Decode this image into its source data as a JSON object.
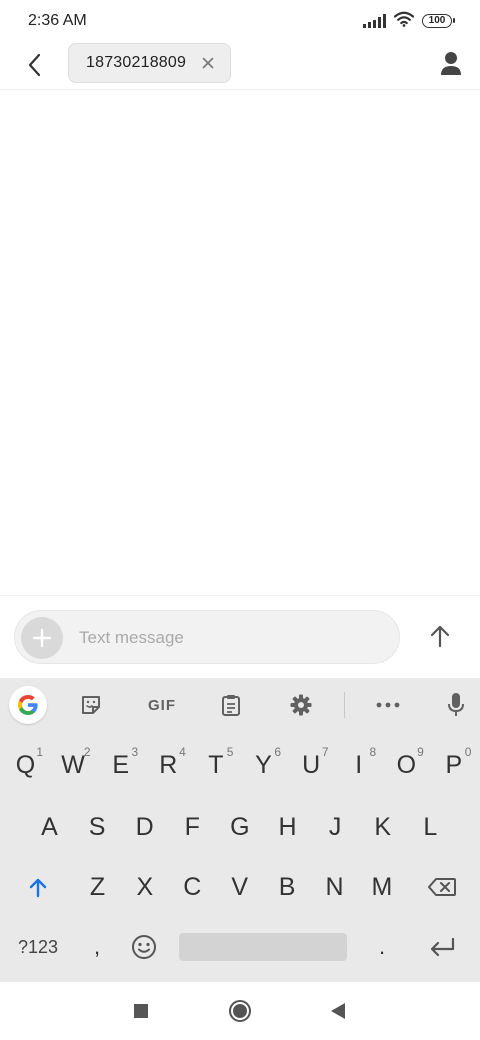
{
  "status_bar": {
    "time": "2:36 AM",
    "battery_level": "100",
    "icons": [
      "signal-icon",
      "wifi-icon",
      "battery-icon"
    ]
  },
  "header": {
    "back_icon": "chevron-left-icon",
    "recipient": "18730218809",
    "remove_icon": "close-icon",
    "contact_icon": "person-icon"
  },
  "compose": {
    "add_icon": "plus-icon",
    "placeholder": "Text message",
    "value": "",
    "send_icon": "arrow-up-icon"
  },
  "keyboard": {
    "toolbar": {
      "google_icon": "google-g-icon",
      "sticker_icon": "sticker-icon",
      "gif_label": "GIF",
      "clipboard_icon": "clipboard-icon",
      "settings_icon": "gear-icon",
      "more_icon": "more-horizontal-icon",
      "mic_icon": "microphone-icon"
    },
    "row1": [
      "Q",
      "W",
      "E",
      "R",
      "T",
      "Y",
      "U",
      "I",
      "O",
      "P"
    ],
    "row1_hints": [
      "1",
      "2",
      "3",
      "4",
      "5",
      "6",
      "7",
      "8",
      "9",
      "0"
    ],
    "row2": [
      "A",
      "S",
      "D",
      "F",
      "G",
      "H",
      "J",
      "K",
      "L"
    ],
    "row3": [
      "Z",
      "X",
      "C",
      "V",
      "B",
      "N",
      "M"
    ],
    "shift_icon": "shift-arrow-icon",
    "backspace_icon": "backspace-icon",
    "symbols_label": "?123",
    "comma_label": ",",
    "emoji_icon": "emoji-icon",
    "period_label": ".",
    "enter_icon": "enter-icon"
  },
  "nav_bar": {
    "recents_icon": "square-icon",
    "home_icon": "circle-icon",
    "back_icon": "triangle-back-icon"
  },
  "colors": {
    "accent_blue": "#4285F4",
    "keyboard_bg": "#E9E9E9",
    "text_dark": "#333333"
  }
}
